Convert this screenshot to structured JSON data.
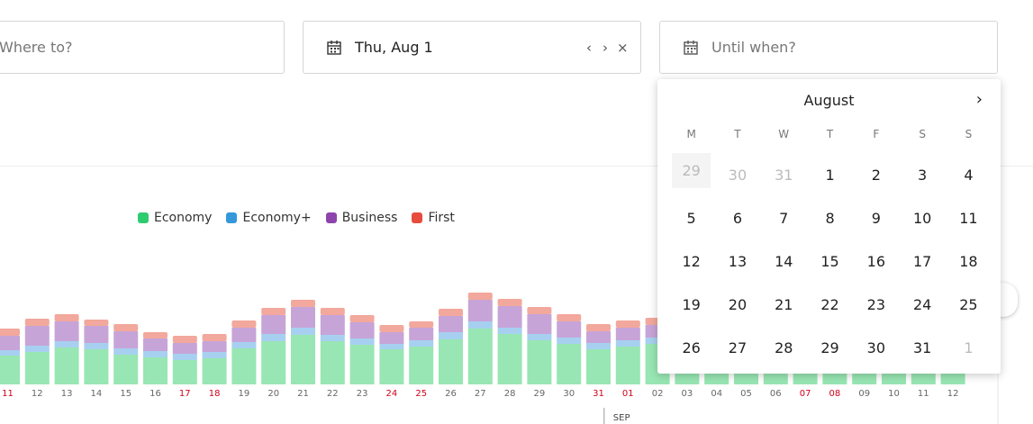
{
  "search": {
    "where_placeholder": "Where to?",
    "from_value": "Thu, Aug 1",
    "from_actions": [
      "‹",
      "›",
      "×"
    ],
    "until_placeholder": "Until when?"
  },
  "legend": [
    {
      "label": "Economy",
      "color": "#2ecc71"
    },
    {
      "label": "Economy+",
      "color": "#3498db"
    },
    {
      "label": "Business",
      "color": "#8e44ad"
    },
    {
      "label": "First",
      "color": "#e74c3c"
    }
  ],
  "chart_data": {
    "type": "bar",
    "stacked": true,
    "categories": [
      "11",
      "12",
      "13",
      "14",
      "15",
      "16",
      "17",
      "18",
      "19",
      "20",
      "21",
      "22",
      "23",
      "24",
      "25",
      "26",
      "27",
      "28",
      "29",
      "30",
      "31",
      "01",
      "02",
      "03",
      "04",
      "05",
      "06",
      "07",
      "08",
      "09",
      "10",
      "11",
      "12"
    ],
    "weekend_categories_indices": [
      0,
      6,
      7,
      13,
      14,
      20,
      21,
      27,
      28
    ],
    "month_marker": {
      "label": "SEP",
      "at_index": 21
    },
    "series": [
      {
        "name": "Economy",
        "color": "#98e6b3",
        "values": [
          32,
          36,
          41,
          39,
          33,
          30,
          27,
          29,
          40,
          48,
          55,
          48,
          44,
          39,
          42,
          50,
          62,
          56,
          49,
          45,
          39,
          42,
          45,
          45,
          45,
          45,
          45,
          45,
          45,
          45,
          45,
          45,
          45
        ]
      },
      {
        "name": "Economy+",
        "color": "#a7d0f0",
        "values": [
          6,
          7,
          7,
          7,
          7,
          7,
          7,
          7,
          7,
          8,
          8,
          7,
          7,
          6,
          7,
          8,
          8,
          7,
          7,
          7,
          7,
          7,
          7,
          7,
          7,
          7,
          7,
          7,
          7,
          7,
          7,
          7,
          7
        ]
      },
      {
        "name": "Business",
        "color": "#c7a4d8",
        "values": [
          16,
          22,
          22,
          19,
          19,
          14,
          12,
          12,
          16,
          21,
          23,
          22,
          18,
          13,
          14,
          18,
          24,
          24,
          22,
          18,
          13,
          14,
          14,
          14,
          14,
          14,
          14,
          14,
          14,
          14,
          14,
          14,
          14
        ]
      },
      {
        "name": "First",
        "color": "#f2a89c",
        "values": [
          8,
          8,
          8,
          7,
          8,
          7,
          8,
          8,
          8,
          8,
          8,
          8,
          8,
          8,
          7,
          8,
          8,
          8,
          8,
          8,
          8,
          8,
          8,
          8,
          8,
          8,
          8,
          8,
          8,
          8,
          8,
          8,
          8
        ]
      }
    ]
  },
  "datepicker": {
    "month": "August",
    "next": "›",
    "weekdays": [
      "M",
      "T",
      "W",
      "T",
      "F",
      "S",
      "S"
    ],
    "days": [
      {
        "d": "29",
        "muted": true,
        "shaded": true
      },
      {
        "d": "30",
        "muted": true
      },
      {
        "d": "31",
        "muted": true
      },
      {
        "d": "1"
      },
      {
        "d": "2"
      },
      {
        "d": "3"
      },
      {
        "d": "4"
      },
      {
        "d": "5"
      },
      {
        "d": "6"
      },
      {
        "d": "7"
      },
      {
        "d": "8"
      },
      {
        "d": "9"
      },
      {
        "d": "10"
      },
      {
        "d": "11"
      },
      {
        "d": "12"
      },
      {
        "d": "13"
      },
      {
        "d": "14"
      },
      {
        "d": "15"
      },
      {
        "d": "16"
      },
      {
        "d": "17"
      },
      {
        "d": "18"
      },
      {
        "d": "19"
      },
      {
        "d": "20"
      },
      {
        "d": "21"
      },
      {
        "d": "22"
      },
      {
        "d": "23"
      },
      {
        "d": "24"
      },
      {
        "d": "25"
      },
      {
        "d": "26"
      },
      {
        "d": "27"
      },
      {
        "d": "28"
      },
      {
        "d": "29"
      },
      {
        "d": "30"
      },
      {
        "d": "31"
      },
      {
        "d": "1",
        "muted": true
      }
    ]
  }
}
